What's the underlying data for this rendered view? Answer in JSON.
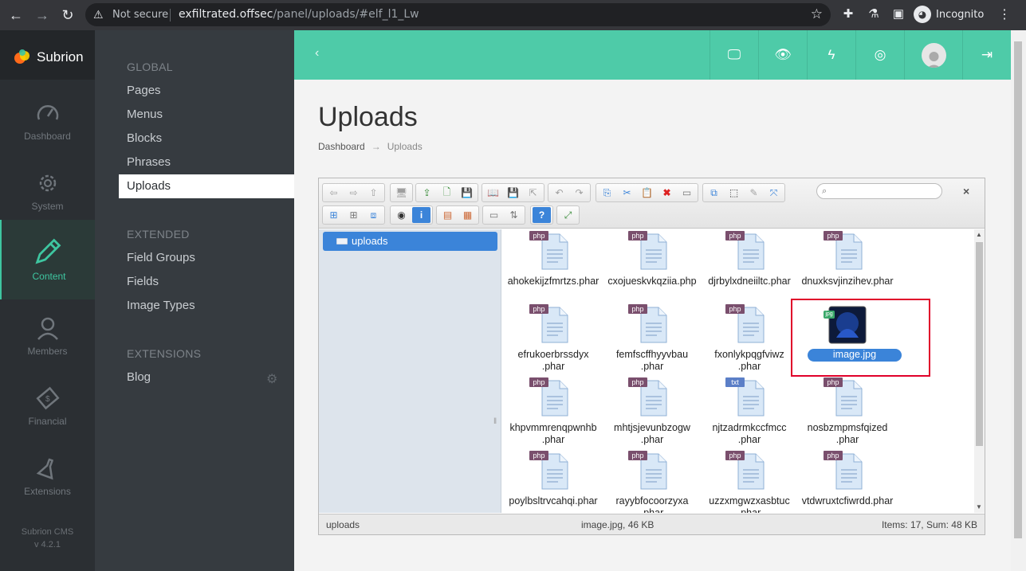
{
  "browser": {
    "not_secure": "Not secure",
    "url_host": "exfiltrated.offsec",
    "url_path": "/panel/uploads/#elf_l1_Lw",
    "incognito": "Incognito"
  },
  "sidebar": {
    "logo": "Subrion",
    "items": [
      {
        "label": "Dashboard",
        "icon": "gauge-icon"
      },
      {
        "label": "System",
        "icon": "gear-icon"
      },
      {
        "label": "Content",
        "icon": "pencil-icon"
      },
      {
        "label": "Members",
        "icon": "user-icon"
      },
      {
        "label": "Financial",
        "icon": "money-icon"
      },
      {
        "label": "Extensions",
        "icon": "flask-icon"
      }
    ],
    "version_line1": "Subrion CMS",
    "version_line2": "v 4.2.1"
  },
  "subnav": {
    "global_header": "GLOBAL",
    "global_items": [
      "Pages",
      "Menus",
      "Blocks",
      "Phrases",
      "Uploads"
    ],
    "extended_header": "EXTENDED",
    "extended_items": [
      "Field Groups",
      "Fields",
      "Image Types"
    ],
    "extensions_header": "EXTENSIONS",
    "extensions_items": [
      "Blog"
    ]
  },
  "page": {
    "title": "Uploads",
    "breadcrumb_home": "Dashboard",
    "breadcrumb_arrow": "→",
    "breadcrumb_current": "Uploads"
  },
  "filemanager": {
    "tree_root": "uploads",
    "files": [
      {
        "line1": "ahokekijzfmrtzs.phar",
        "line2": "",
        "badge": "php"
      },
      {
        "line1": "cxojueskvkqziia.php",
        "line2": "",
        "badge": "php"
      },
      {
        "line1": "djrbylxdneiiltc.phar",
        "line2": "",
        "badge": "php"
      },
      {
        "line1": "dnuxksvjinzihev.phar",
        "line2": "",
        "badge": "php"
      },
      {
        "line1": "efrukoerbrssdyx",
        "line2": ".phar",
        "badge": "php"
      },
      {
        "line1": "femfscffhyyvbau",
        "line2": ".phar",
        "badge": "php"
      },
      {
        "line1": "fxonlykpqgfviwz",
        "line2": ".phar",
        "badge": "php"
      },
      {
        "line1": "image.jpg",
        "line2": "",
        "badge": "jpg"
      },
      {
        "line1": "khpvmmrenqpwnhb",
        "line2": ".phar",
        "badge": "php"
      },
      {
        "line1": "mhtjsjevunbzogw",
        "line2": ".phar",
        "badge": "php"
      },
      {
        "line1": "njtzadrmkccfmcc",
        "line2": ".phar",
        "badge": "txt"
      },
      {
        "line1": "nosbzmpmsfqized",
        "line2": ".phar",
        "badge": "php"
      },
      {
        "line1": "poylbsltrvcahqi.phar",
        "line2": "",
        "badge": "php"
      },
      {
        "line1": "rayybfocoorzyxa",
        "line2": ".phar",
        "badge": "php"
      },
      {
        "line1": "uzzxmgwzxasbtuc",
        "line2": ".phar",
        "badge": "php"
      },
      {
        "line1": "vtdwruxtcfiwrdd.phar",
        "line2": "",
        "badge": "php"
      }
    ],
    "status_path": "uploads",
    "status_selected": "image.jpg, 46 KB",
    "status_items": "Items: 17, Sum: 48 KB",
    "close_label": "×"
  },
  "colors": {
    "accent": "#4ecba8",
    "selection": "#3b84d9",
    "highlight": "#e0002a"
  }
}
